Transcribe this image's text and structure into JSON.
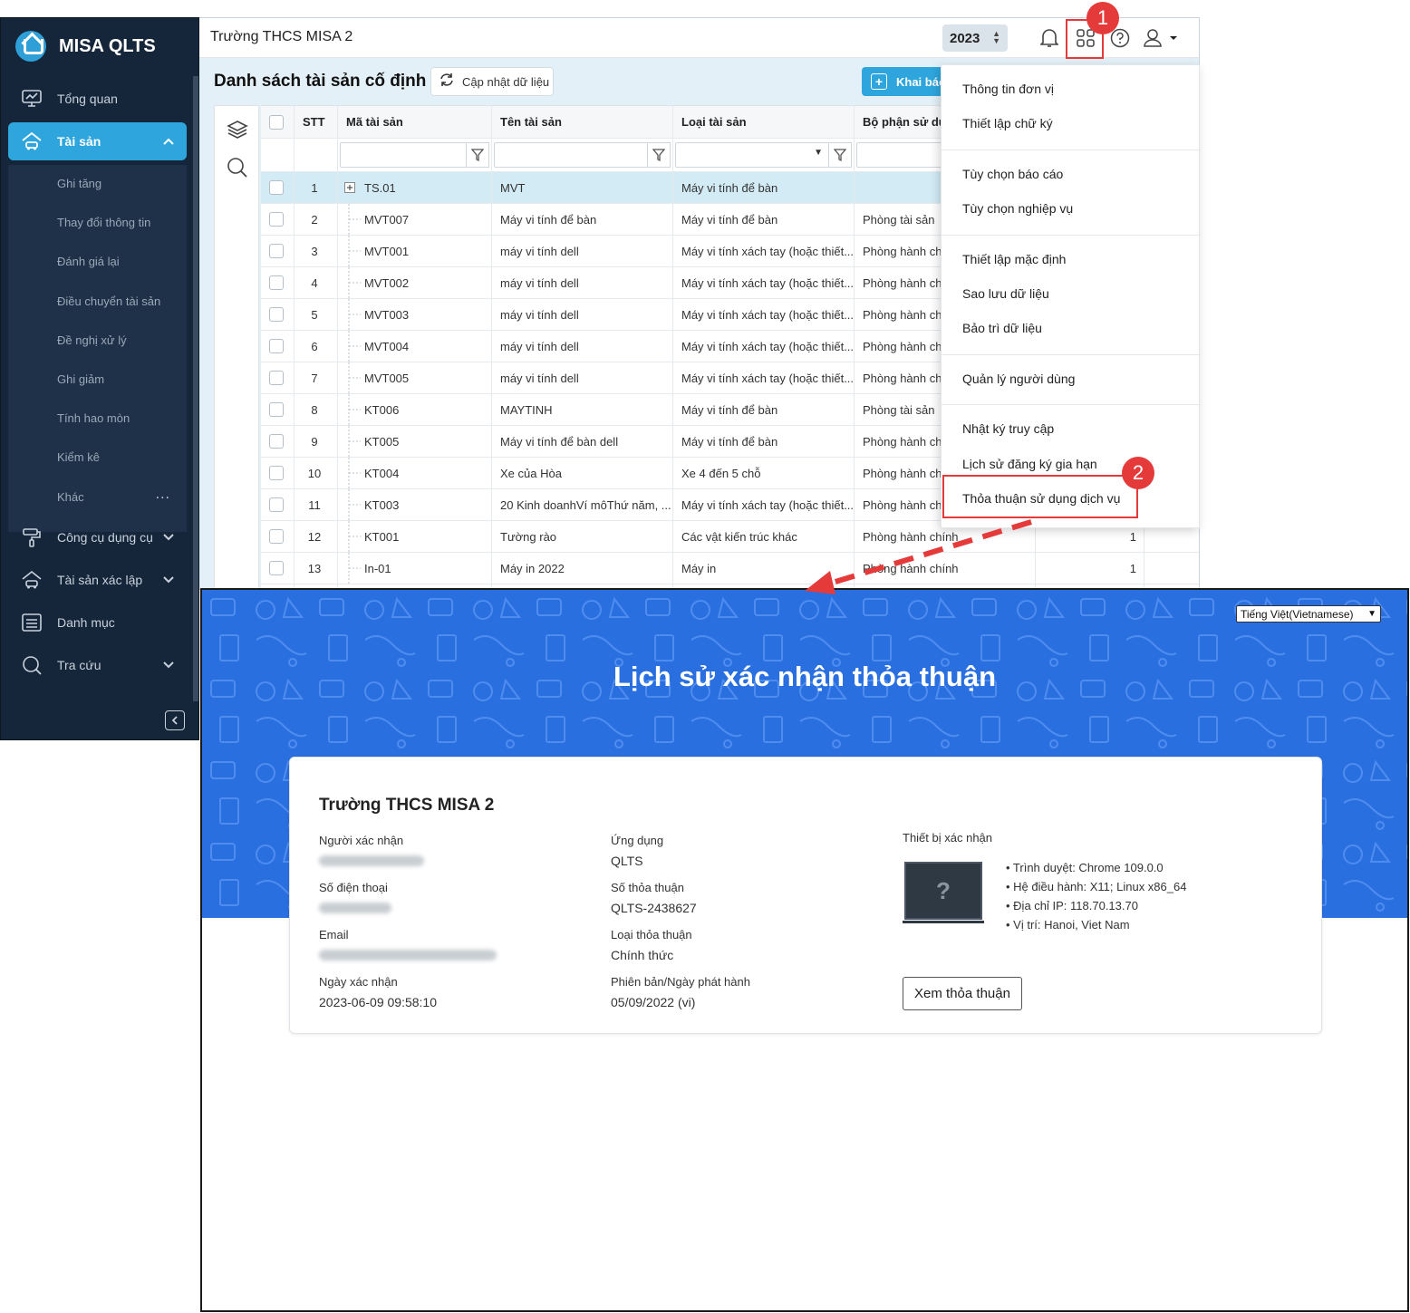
{
  "app": {
    "brand": "MISA QLTS",
    "org": "Trường THCS MISA 2",
    "year": "2023"
  },
  "sidebar": {
    "items": [
      {
        "label": "Tổng quan"
      },
      {
        "label": "Tài sản"
      },
      {
        "label": "Công cụ dụng cụ"
      },
      {
        "label": "Tài sản xác lập"
      },
      {
        "label": "Danh mục"
      },
      {
        "label": "Tra cứu"
      }
    ],
    "sub_items": [
      "Ghi tăng",
      "Thay đổi thông tin",
      "Đánh giá lại",
      "Điều chuyển tài sản",
      "Đề nghị xử lý",
      "Ghi giảm",
      "Tính hao mòn",
      "Kiểm kê",
      "Khác"
    ],
    "more": "..."
  },
  "page": {
    "title": "Danh sách tài sản cố định",
    "refresh_label": "Cập nhật dữ liệu",
    "add_label": "Khai báo"
  },
  "table": {
    "headers": [
      "STT",
      "Mã tài sản",
      "Tên tài sản",
      "Loại tài sản",
      "Bộ phận sử dụng"
    ],
    "rows": [
      {
        "stt": "1",
        "code": "TS.01",
        "name": "MVT",
        "type": "Máy vi tính để bàn",
        "dept": ""
      },
      {
        "stt": "2",
        "code": "MVT007",
        "name": "Máy vi tính để bàn",
        "type": "Máy vi tính để bàn",
        "dept": "Phòng tài sản"
      },
      {
        "stt": "3",
        "code": "MVT001",
        "name": "máy vi tính dell",
        "type": "Máy vi tính xách tay (hoặc thiết...",
        "dept": "Phòng hành ch"
      },
      {
        "stt": "4",
        "code": "MVT002",
        "name": "máy vi tính dell",
        "type": "Máy vi tính xách tay (hoặc thiết...",
        "dept": "Phòng hành ch"
      },
      {
        "stt": "5",
        "code": "MVT003",
        "name": "máy vi tính dell",
        "type": "Máy vi tính xách tay (hoặc thiết...",
        "dept": "Phòng hành ch"
      },
      {
        "stt": "6",
        "code": "MVT004",
        "name": "máy vi tính dell",
        "type": "Máy vi tính xách tay (hoặc thiết...",
        "dept": "Phòng hành ch"
      },
      {
        "stt": "7",
        "code": "MVT005",
        "name": "máy vi tính dell",
        "type": "Máy vi tính xách tay (hoặc thiết...",
        "dept": "Phòng hành ch"
      },
      {
        "stt": "8",
        "code": "KT006",
        "name": "MAYTINH",
        "type": "Máy vi tính để bàn",
        "dept": "Phòng tài sản"
      },
      {
        "stt": "9",
        "code": "KT005",
        "name": "Máy vi tính để bàn dell",
        "type": "Máy vi tính để bàn",
        "dept": "Phòng hành ch"
      },
      {
        "stt": "10",
        "code": "KT004",
        "name": "Xe của Hòa",
        "type": "Xe 4 đến 5 chỗ",
        "dept": "Phòng hành ch"
      },
      {
        "stt": "11",
        "code": "KT003",
        "name": "20 Kinh doanhVí môThứ năm, ...",
        "type": "Máy vi tính xách tay (hoặc thiết...",
        "dept": "Phòng hành ch"
      },
      {
        "stt": "12",
        "code": "KT001",
        "name": "Tường rào",
        "type": "Các vật kiến trúc khác",
        "dept": "Phòng hành chính",
        "qty": "1"
      },
      {
        "stt": "13",
        "code": "In-01",
        "name": "Máy in 2022",
        "type": "Máy in",
        "dept": "Phòng hành chính",
        "qty": "1"
      }
    ]
  },
  "menu": {
    "items": [
      "Thông tin đơn vị",
      "Thiết lập chữ ký",
      "Tùy chọn báo cáo",
      "Tùy chọn nghiệp vụ",
      "Thiết lập mặc định",
      "Sao lưu dữ liệu",
      "Bảo trì dữ liệu",
      "Quản lý người dùng",
      "Nhật ký truy cập",
      "Lịch sử đăng ký gia hạn",
      "Thỏa thuận sử dụng dịch vụ"
    ]
  },
  "badges": [
    "1",
    "2"
  ],
  "consent": {
    "language": "Tiếng Việt(Vietnamese)",
    "title": "Lịch sử xác nhận thỏa thuận",
    "org": "Trường THCS MISA 2",
    "confirmer_label": "Người xác nhận",
    "phone_label": "Số điện thoại",
    "email_label": "Email",
    "date_label": "Ngày xác nhận",
    "date_value": "2023-06-09 09:58:10",
    "app_label": "Ứng dụng",
    "app_value": "QLTS",
    "agreement_no_label": "Số thỏa thuận",
    "agreement_no_value": "QLTS-2438627",
    "agreement_type_label": "Loại thỏa thuận",
    "agreement_type_value": "Chính thức",
    "version_label": "Phiên bản/Ngày phát hành",
    "version_value": "05/09/2022 (vi)",
    "device_label": "Thiết bị xác nhận",
    "device_glyph": "?",
    "browser": "• Trình duyệt: Chrome 109.0.0",
    "os": "• Hệ điều hành: X11; Linux x86_64",
    "ip": "• Địa chỉ IP: 118.70.13.70",
    "location": "• Vị trí: Hanoi, Viet Nam",
    "view_button": "Xem thỏa thuận"
  },
  "colors": {
    "accent": "#2ea6dd",
    "sidebar": "#16263a",
    "banner": "#2a6fe0",
    "highlight": "#e53a3a"
  }
}
